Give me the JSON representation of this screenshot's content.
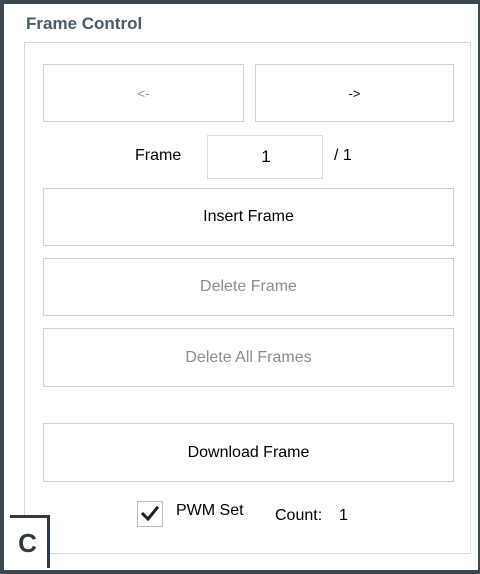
{
  "panel": {
    "title": "Frame Control"
  },
  "navigation": {
    "prev_label": "<-",
    "next_label": "->"
  },
  "frame": {
    "label": "Frame",
    "current_value": "1",
    "total_label": "/ 1"
  },
  "actions": {
    "insert_label": "Insert Frame",
    "delete_label": "Delete Frame",
    "delete_all_label": "Delete All Frames",
    "download_label": "Download Frame"
  },
  "pwm": {
    "checked": true,
    "checkbox_label": "PWM Set",
    "count_label": "Count:",
    "count_value": "1"
  },
  "figure_label": "C",
  "colors": {
    "border": "#3a4650",
    "title": "#4a5a66",
    "disabled_text": "#8c8c8c"
  },
  "icons": {
    "checkbox": "check-mark-icon"
  }
}
